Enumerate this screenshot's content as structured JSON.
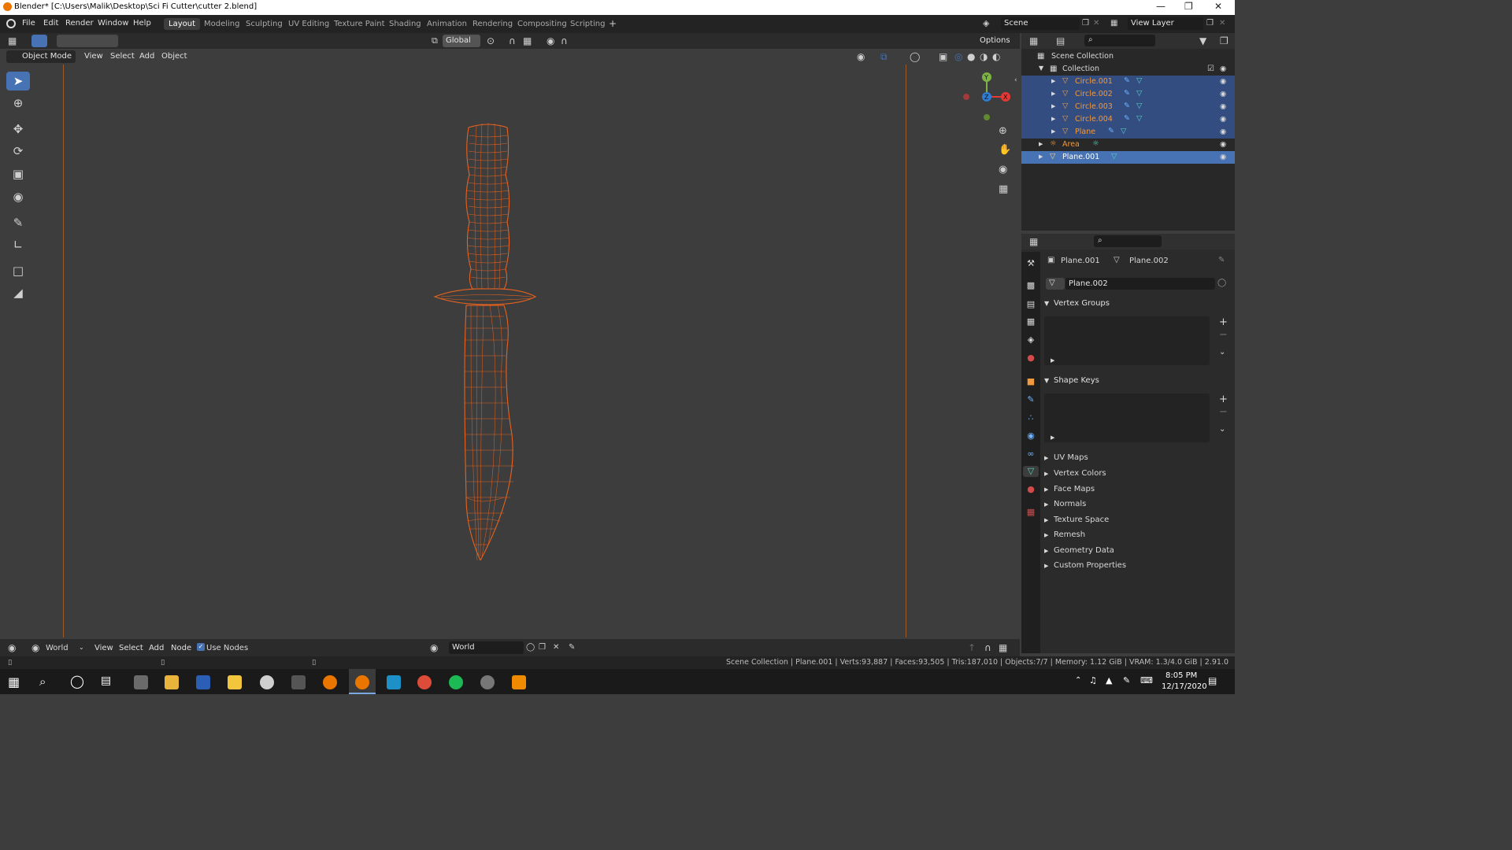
{
  "window": {
    "title": "Blender* [C:\\Users\\Malik\\Desktop\\Sci Fi Cutter\\cutter 2.blend]"
  },
  "menu": [
    "File",
    "Edit",
    "Render",
    "Window",
    "Help"
  ],
  "workspaces": [
    "Layout",
    "Modeling",
    "Sculpting",
    "UV Editing",
    "Texture Paint",
    "Shading",
    "Animation",
    "Rendering",
    "Compositing",
    "Scripting"
  ],
  "active_workspace": "Layout",
  "scene": {
    "name": "Scene",
    "view_layer": "View Layer"
  },
  "viewport_header": {
    "transform_orientation": "Global",
    "options": "Options",
    "mode": "Object Mode",
    "menus": [
      "View",
      "Select",
      "Add",
      "Object"
    ]
  },
  "tools": [
    "select-box",
    "cursor",
    "move",
    "rotate",
    "scale",
    "transform",
    "annotate",
    "measure",
    "add-cube",
    "add-plane"
  ],
  "gizmo": {
    "y": "Y",
    "z": "Z",
    "x": "X"
  },
  "outliner": {
    "root": "Scene Collection",
    "collection": "Collection",
    "items": [
      {
        "name": "Circle.001",
        "type": "mesh"
      },
      {
        "name": "Circle.002",
        "type": "mesh"
      },
      {
        "name": "Circle.003",
        "type": "mesh"
      },
      {
        "name": "Circle.004",
        "type": "mesh"
      },
      {
        "name": "Plane",
        "type": "mesh"
      },
      {
        "name": "Area",
        "type": "light"
      },
      {
        "name": "Plane.001",
        "type": "mesh",
        "active": true
      }
    ]
  },
  "properties": {
    "object": "Plane.001",
    "mesh": "Plane.002",
    "datablock": "Plane.002",
    "open_panels": [
      "Vertex Groups",
      "Shape Keys"
    ],
    "closed_panels": [
      "UV Maps",
      "Vertex Colors",
      "Face Maps",
      "Normals",
      "Texture Space",
      "Remesh",
      "Geometry Data",
      "Custom Properties"
    ]
  },
  "node_header": {
    "world_type": "World",
    "menus": [
      "View",
      "Select",
      "Add",
      "Node"
    ],
    "use_nodes_label": "Use Nodes",
    "use_nodes": true,
    "world_name": "World"
  },
  "status": "Scene Collection | Plane.001 | Verts:93,887 | Faces:93,505 | Tris:187,010 | Objects:7/7 | Memory: 1.12 GiB | VRAM: 1.3/4.0 GiB | 2.91.0",
  "taskbar": {
    "time": "8:05 PM",
    "date": "12/17/2020"
  },
  "colors": {
    "accent": "#4772b3",
    "wire": "#e8621e",
    "selected_row": "#334d80"
  }
}
